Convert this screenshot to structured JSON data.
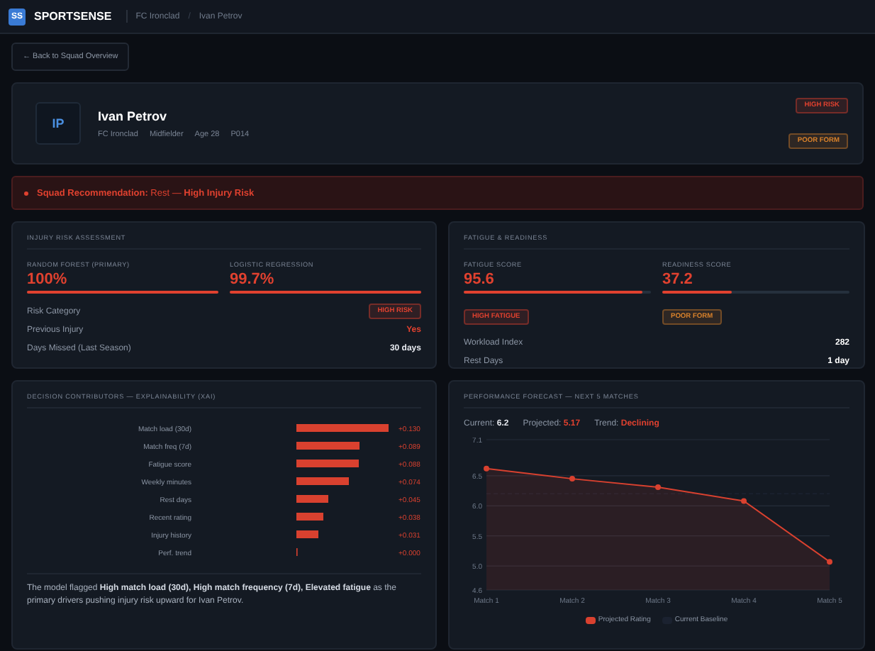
{
  "topbar": {
    "logo": "SS",
    "brand": "SPORTSENSE",
    "breadcrumb": [
      "FC Ironclad",
      "Ivan Petrov"
    ],
    "separator": "/"
  },
  "back_button": "← Back to Squad Overview",
  "profile": {
    "initials": "IP",
    "name": "Ivan Petrov",
    "meta": [
      "FC Ironclad",
      "Midfielder",
      "Age 28",
      "P014"
    ],
    "badges": [
      {
        "label": "HIGH RISK",
        "color": "#e0412f"
      },
      {
        "label": "POOR FORM",
        "color": "#d9822b"
      }
    ]
  },
  "alert": "**Squad Recommendation:** Rest — **High Injury Risk**",
  "injury_card": {
    "title": "INJURY RISK ASSESSMENT",
    "models": [
      {
        "label": "RANDOM FOREST (PRIMARY)",
        "value": "100%",
        "level": 1.0
      },
      {
        "label": "LOGISTIC REGRESSION",
        "value": "99.7%",
        "level": 0.997
      }
    ],
    "rows": [
      {
        "label": "Risk Category",
        "kind": "badge",
        "value": "HIGH RISK",
        "color": "#e0412f"
      },
      {
        "label": "Previous Injury",
        "kind": "text",
        "value": "Yes",
        "color": "#e0412f"
      },
      {
        "label": "Days Missed (Last Season)",
        "kind": "text",
        "value": "30 days",
        "color": "#e6e9ef"
      }
    ]
  },
  "fatigue_card": {
    "title": "FATIGUE & READINESS",
    "scores": [
      {
        "label": "FATIGUE SCORE",
        "value": "95.6",
        "level": 0.956,
        "badge": "HIGH FATIGUE",
        "color": "#e0412f"
      },
      {
        "label": "READINESS SCORE",
        "value": "37.2",
        "level": 0.372,
        "badge": "POOR FORM",
        "color": "#d9822b"
      }
    ],
    "rows": [
      {
        "label": "Workload Index",
        "value": "282"
      },
      {
        "label": "Rest Days",
        "value": "1 day"
      }
    ]
  },
  "xai_card": {
    "title": "DECISION CONTRIBUTORS — EXPLAINABILITY (XAI)",
    "chart_data": {
      "type": "bar",
      "orientation": "horizontal",
      "categories": [
        "Match load (30d)",
        "Match freq (7d)",
        "Fatigue score",
        "Weekly minutes",
        "Rest days",
        "Recent rating",
        "Injury history",
        "Perf. trend"
      ],
      "values": [
        0.13,
        0.089,
        0.088,
        0.074,
        0.045,
        0.038,
        0.031,
        0.0
      ],
      "value_labels": [
        "+0.130",
        "+0.089",
        "+0.088",
        "+0.074",
        "+0.045",
        "+0.038",
        "+0.031",
        "+0.000"
      ]
    },
    "summary": "The model flagged **High match load (30d), High match frequency (7d), Elevated fatigue** as the primary drivers pushing injury risk upward for Ivan Petrov."
  },
  "forecast_card": {
    "title": "PERFORMANCE FORECAST — NEXT 5 MATCHES",
    "stats": [
      {
        "label": "Current:",
        "value": "6.2",
        "color": "#e6e9ef"
      },
      {
        "label": "Projected:",
        "value": "5.17",
        "color": "#e0412f"
      },
      {
        "label": "Trend:",
        "value": "Declining",
        "color": "#e0412f"
      }
    ],
    "chart_data": {
      "type": "area",
      "categories": [
        "Match 1",
        "Match 2",
        "Match 3",
        "Match 4",
        "Match 5"
      ],
      "ylim": [
        4.6,
        7.1
      ],
      "yticks": [
        4.6,
        {
          "value": 5,
          "label": "5.0"
        },
        5.5,
        {
          "value": 6,
          "label": "6.0"
        },
        6.5,
        7.1
      ],
      "series": [
        {
          "name": "Projected Rating",
          "color": "#d9412f",
          "values": [
            6.62,
            6.45,
            6.31,
            6.08,
            5.07
          ]
        },
        {
          "name": "Current Baseline",
          "type": "line",
          "line_style": "dashed",
          "color": "#1b2230",
          "values": [
            6.2,
            6.2,
            6.2,
            6.2,
            6.2
          ]
        }
      ]
    }
  }
}
